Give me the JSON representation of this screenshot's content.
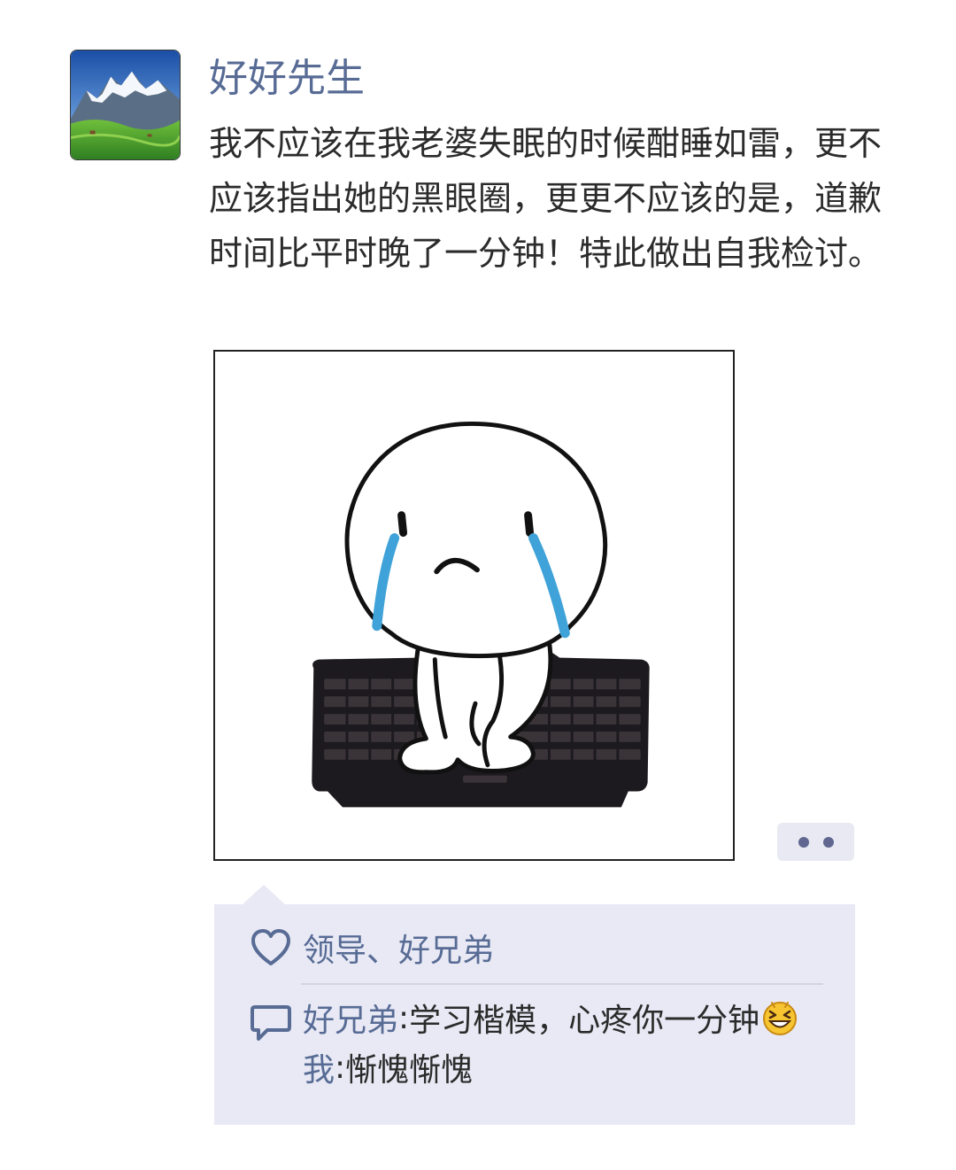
{
  "post": {
    "username": "好好先生",
    "text": "我不应该在我老婆失眠的时候酣睡如雷，更不应该指出她的黑眼圈，更更不应该的是，道歉时间比平时晚了一分钟！特此做出自我检讨。"
  },
  "interactions": {
    "likes": "领导、好兄弟",
    "comments": [
      {
        "author": "好兄弟",
        "separator": ":",
        "text": "学习楷模，心疼你一分钟",
        "emoji": "grinning-squint-emoji"
      },
      {
        "author": "我",
        "separator": ":",
        "text": "惭愧惭愧"
      }
    ]
  },
  "icons": {
    "like": "heart-outline-icon",
    "comment": "speech-bubble-icon",
    "more": "two-dots-icon"
  },
  "colors": {
    "username": "#576b95",
    "panel": "#e8e9f4",
    "tear": "#3fa2d8"
  }
}
